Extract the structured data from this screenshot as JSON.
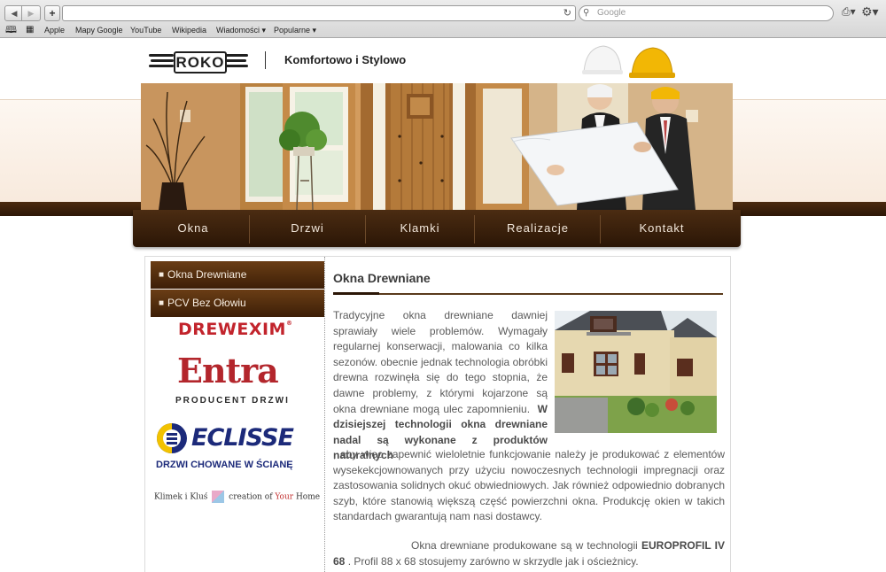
{
  "browser": {
    "back_icon": "◀",
    "forward_icon": "▶",
    "add_icon": "+",
    "reload_icon": "↻",
    "search_placeholder": "Google",
    "bookmarks": [
      "Apple",
      "Mapy Google",
      "YouTube",
      "Wikipedia",
      "Wiadomości ▾",
      "Popularne ▾"
    ]
  },
  "header": {
    "logo_text": "ROKO",
    "tagline": "Komfortowo i Stylowo"
  },
  "nav": {
    "items": [
      "Okna",
      "Drzwi",
      "Klamki",
      "Realizacje",
      "Kontakt"
    ]
  },
  "sidebar": {
    "items": [
      "Okna Drewniane",
      "PCV Bez Ołowiu"
    ],
    "brands": {
      "drewexim": "DREWEXIM",
      "entra": "Entra",
      "entra_sub": "PRODUCENT DRZWI",
      "eclisse": "ECLISSE",
      "eclisse_sub": "DRZWI CHOWANE W ŚCIANĘ",
      "klimek_a": "Klimek i Kluś",
      "klimek_b": "creation of ",
      "klimek_c": "Your",
      "klimek_d": " Home"
    }
  },
  "main": {
    "title": "Okna Drewniane",
    "p1_start": "Tradycyjne okna drewniane dawniej sprawiały wiele problemów. Wymagały regularnej konserwacji, malowania co kilka sezonów. obecnie jednak technologia obróbki drewna rozwinęła się do tego stopnia, że dawne problemy, z którymi kojarzone są okna drewniane mogą ulec zapomnieniu.",
    "p1_bold": "W dzisiejszej technologii okna drewniane nadal są wykonane z produktów naturalnych",
    "p1_end": ", aby więc zapewnić wieloletnie funkcjowanie należy je produkować z elementów wysekekcjownowanych przy użyciu nowoczesnych technologii impregnacji oraz zastosowania solidnych okuć obwiedniowych. Jak również odpowiednio dobranych szyb, które stanowią większą część powierzchni okna. Produkcję okien w takich standardach gwarantują nam nasi dostawcy.",
    "p2_start": "Okna drewniane produkowane są w technologii ",
    "p2_bold": "EUROPROFIL IV 68",
    "p2_end": " . Profil 88 x 68 stosujemy zarówno w skrzydle jak i ościeżnicy."
  },
  "colors": {
    "brown_dark": "#2b1606",
    "brown": "#4b2c12",
    "cream": "#fdf7f1",
    "brand_red": "#c2242c",
    "eclisse_blue": "#1c2a7a"
  }
}
